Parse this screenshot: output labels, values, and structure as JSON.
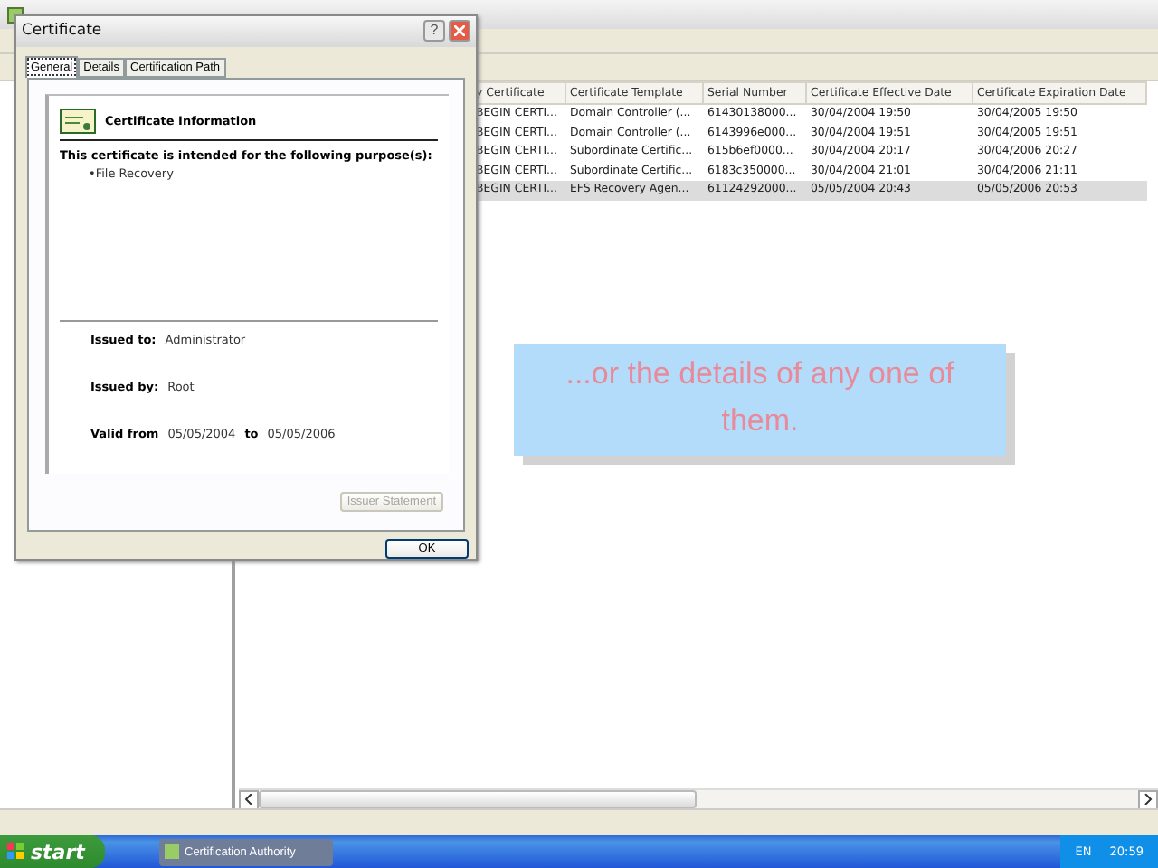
{
  "table": {
    "columns": [
      "y Certificate",
      "Certificate Template",
      "Serial Number",
      "Certificate Effective Date",
      "Certificate Expiration Date"
    ],
    "rows": [
      {
        "cells": [
          "BEGIN CERTI...",
          "Domain Controller (...",
          "61430138000...",
          "30/04/2004 19:50",
          "30/04/2005 19:50"
        ],
        "selected": false
      },
      {
        "cells": [
          "BEGIN CERTI...",
          "Domain Controller (...",
          "6143996e000...",
          "30/04/2004 19:51",
          "30/04/2005 19:51"
        ],
        "selected": false
      },
      {
        "cells": [
          "BEGIN CERTI...",
          "Subordinate Certific...",
          "615b6ef0000...",
          "30/04/2004 20:17",
          "30/04/2006 20:27"
        ],
        "selected": false
      },
      {
        "cells": [
          "BEGIN CERTI...",
          "Subordinate Certific...",
          "6183c350000...",
          "30/04/2004 21:01",
          "30/04/2006 21:11"
        ],
        "selected": false
      },
      {
        "cells": [
          "BEGIN CERTI...",
          "EFS Recovery Agen...",
          "61124292000...",
          "05/05/2004 20:43",
          "05/05/2006 20:53"
        ],
        "selected": true
      }
    ]
  },
  "dialog": {
    "title": "Certificate",
    "help": "?",
    "tabs": [
      {
        "label": "General",
        "selected": true
      },
      {
        "label": "Details",
        "selected": false
      },
      {
        "label": "Certification Path",
        "selected": false
      }
    ],
    "heading": "Certificate Information",
    "purpose_intro": "This certificate is intended for the following purpose(s):",
    "purposes": [
      "•File Recovery"
    ],
    "issued_to_label": "Issued to:",
    "issued_to": "Administrator",
    "issued_by_label": "Issued by:",
    "issued_by": "Root",
    "valid_from_label": "Valid from",
    "valid_from": "05/05/2004",
    "valid_to_label": "to",
    "valid_to": "05/05/2006",
    "issuer_statement": {
      "label": "Issuer Statement",
      "disabled": true
    },
    "ok": "OK"
  },
  "callout": "...or the details of any one of them.",
  "taskbar": {
    "start": "start",
    "tasks": [
      {
        "label": "Certification Authority",
        "selected": true
      }
    ],
    "language": "EN",
    "clock": "20:59"
  }
}
